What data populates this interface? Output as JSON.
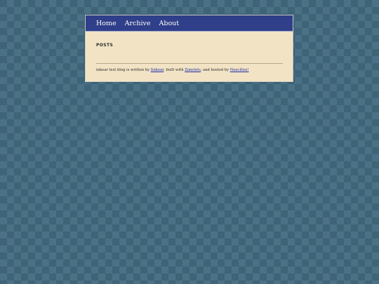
{
  "nav": {
    "items": [
      {
        "label": "Home"
      },
      {
        "label": "Archive"
      },
      {
        "label": "About"
      }
    ]
  },
  "main": {
    "section_title": "POSTS"
  },
  "footer": {
    "text_1": "inkear test blog is written by ",
    "link_author": "Iinkear",
    "text_2": ", built with ",
    "link_builder": "Zonelets",
    "text_3": ", and hosted by ",
    "link_host": "Neocities!"
  },
  "colors": {
    "background": "#3f6478",
    "background_diamond": "#4a7186",
    "nav_bar": "#2f3f8a",
    "content_panel": "#f2e3c5",
    "link": "#1a2aa8"
  }
}
